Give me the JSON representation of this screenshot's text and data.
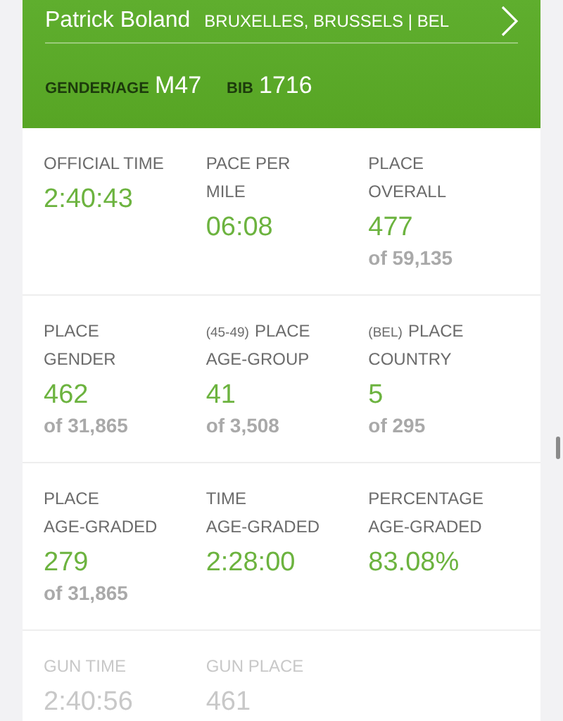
{
  "athlete": {
    "name": "Patrick Boland",
    "location": "BRUXELLES, BRUSSELS | BEL",
    "gender_age_label": "GENDER/AGE",
    "gender_age": "M47",
    "bib_label": "BIB",
    "bib": "1716"
  },
  "sections": [
    {
      "dimmed": false,
      "stats": [
        {
          "label_lines": [
            "OFFICIAL TIME"
          ],
          "value": "2:40:43"
        },
        {
          "label_lines": [
            "PACE PER",
            "MILE"
          ],
          "value": "06:08"
        },
        {
          "label_lines": [
            "PLACE",
            "OVERALL"
          ],
          "value": "477",
          "of": "of 59,135"
        }
      ]
    },
    {
      "dimmed": false,
      "stats": [
        {
          "label_lines": [
            "PLACE",
            "GENDER"
          ],
          "value": "462",
          "of": "of 31,865"
        },
        {
          "prefix": "(45-49)",
          "label_lines": [
            "PLACE",
            "AGE-GROUP"
          ],
          "value": "41",
          "of": "of 3,508"
        },
        {
          "prefix": "(BEL)",
          "label_lines": [
            "PLACE",
            "COUNTRY"
          ],
          "value": "5",
          "of": "of 295"
        }
      ]
    },
    {
      "dimmed": false,
      "stats": [
        {
          "label_lines": [
            "PLACE",
            "AGE-GRADED"
          ],
          "value": "279",
          "of": "of 31,865"
        },
        {
          "label_lines": [
            "TIME",
            "AGE-GRADED"
          ],
          "value": "2:28:00"
        },
        {
          "label_lines": [
            "PERCENTAGE",
            "AGE-GRADED"
          ],
          "value": "83.08%"
        }
      ]
    },
    {
      "dimmed": true,
      "stats": [
        {
          "label_lines": [
            "GUN TIME"
          ],
          "value": "2:40:56"
        },
        {
          "label_lines": [
            "GUN PLACE"
          ],
          "value": "461"
        }
      ]
    }
  ]
}
